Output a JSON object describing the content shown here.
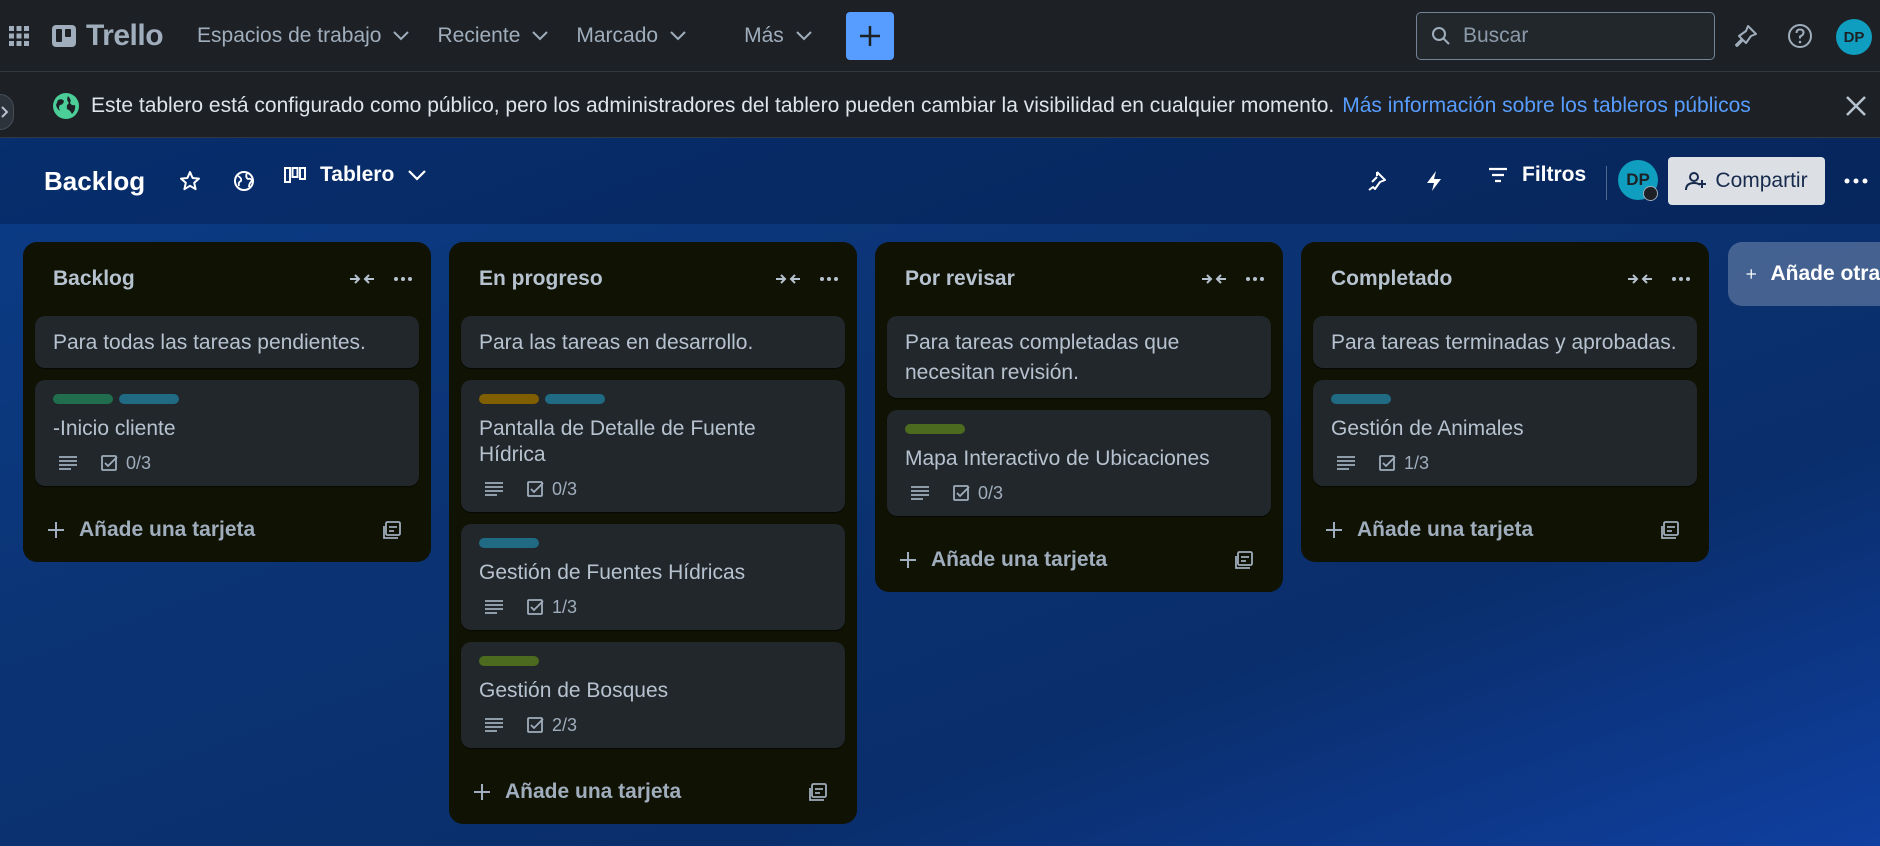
{
  "app": {
    "name": "Trello"
  },
  "nav": {
    "items": [
      {
        "label": "Espacios de trabajo"
      },
      {
        "label": "Reciente"
      },
      {
        "label": "Marcado"
      },
      {
        "label": "Más"
      }
    ],
    "search_placeholder": "Buscar",
    "user_initials": "DP"
  },
  "banner": {
    "text": "Este tablero está configurado como público, pero los administradores del tablero pueden cambiar la visibilidad en cualquier momento.",
    "link": "Más información sobre los tableros públicos"
  },
  "board": {
    "title": "Backlog",
    "view": "Tablero",
    "filters": "Filtros",
    "member_initials": "DP",
    "share": "Compartir",
    "add_list": "Añade otra lista"
  },
  "colors": {
    "accent": "#579dff",
    "label_green": "#216e4e",
    "label_teal": "#206a83",
    "label_yellow": "#7f5f01",
    "label_lime": "#4c6b1f"
  },
  "lists": [
    {
      "title": "Backlog",
      "description": "Para todas las tareas pendientes.",
      "cards": [
        {
          "title": "-Inicio cliente",
          "checklist": "0/3",
          "labels": [
            "#216e4e",
            "#206a83"
          ]
        }
      ],
      "add_card": "Añade una tarjeta"
    },
    {
      "title": "En progreso",
      "description": "Para las tareas en desarrollo.",
      "cards": [
        {
          "title": "Pantalla de Detalle de Fuente Hídrica",
          "checklist": "0/3",
          "labels": [
            "#7f5f01",
            "#206a83"
          ]
        },
        {
          "title": "Gestión de Fuentes Hídricas",
          "checklist": "1/3",
          "labels": [
            "#206a83"
          ]
        },
        {
          "title": "Gestión de Bosques",
          "checklist": "2/3",
          "labels": [
            "#4c6b1f"
          ]
        }
      ],
      "add_card": "Añade una tarjeta"
    },
    {
      "title": "Por revisar",
      "description": "Para tareas completadas que necesitan revisión.",
      "cards": [
        {
          "title": "Mapa Interactivo de Ubicaciones",
          "checklist": "0/3",
          "labels": [
            "#4c6b1f"
          ]
        }
      ],
      "add_card": "Añade una tarjeta"
    },
    {
      "title": "Completado",
      "description": "Para tareas terminadas y aprobadas.",
      "cards": [
        {
          "title": "Gestión de Animales",
          "checklist": "1/3",
          "labels": [
            "#206a83"
          ]
        }
      ],
      "add_card": "Añade una tarjeta"
    }
  ]
}
